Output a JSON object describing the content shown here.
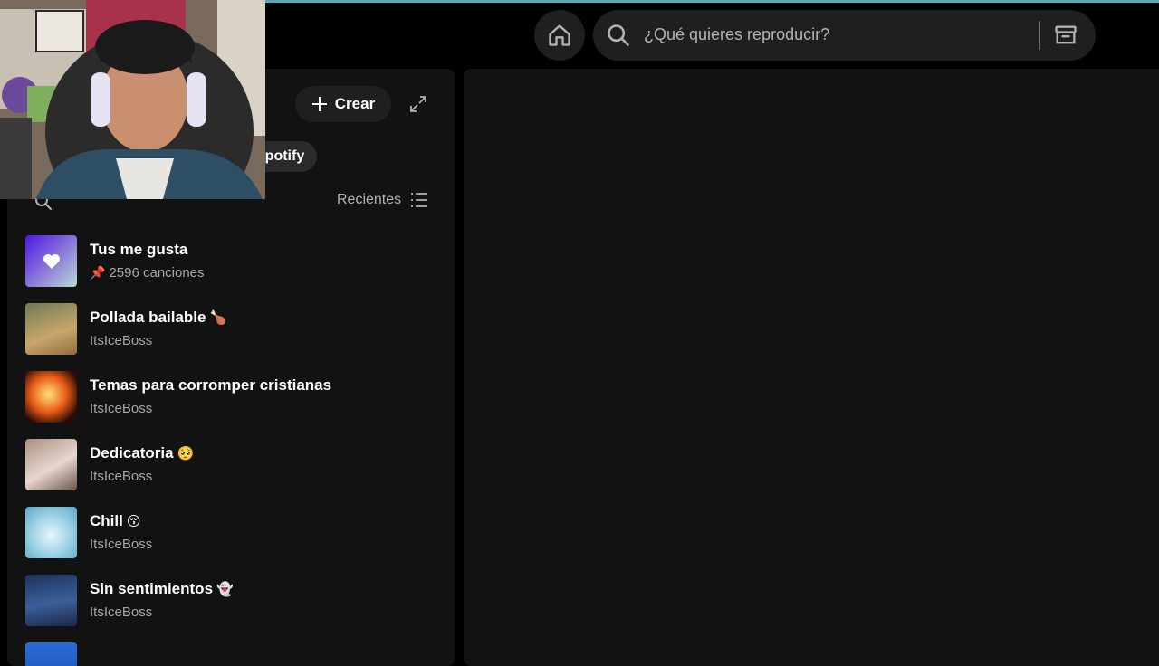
{
  "topbar": {
    "search_placeholder": "¿Qué quieres reproducir?",
    "home_icon": "home-icon",
    "browse_icon": "browse-icon"
  },
  "library": {
    "create_label": "Crear",
    "filter_chip": "Spotify",
    "sort_label": "Recientes",
    "items": [
      {
        "title": "Tus me gusta",
        "sub": "2596 canciones",
        "pinned": true,
        "emoji": ""
      },
      {
        "title": "Pollada bailable",
        "sub": "ItsIceBoss",
        "emoji": "🍗"
      },
      {
        "title": "Temas para corromper cristianas",
        "sub": "ItsIceBoss",
        "emoji": ""
      },
      {
        "title": "Dedicatoria",
        "sub": "ItsIceBoss",
        "emoji": "🥺"
      },
      {
        "title": "Chill",
        "sub": "ItsIceBoss",
        "emoji": "😚"
      },
      {
        "title": "Sin sentimientos",
        "sub": "ItsIceBoss",
        "emoji": "👻"
      }
    ]
  },
  "colors": {
    "accent": "#1ed760",
    "panel": "#121212",
    "liked_gradient_start": "#4b17e6",
    "liked_gradient_end": "#b5dcd6"
  }
}
